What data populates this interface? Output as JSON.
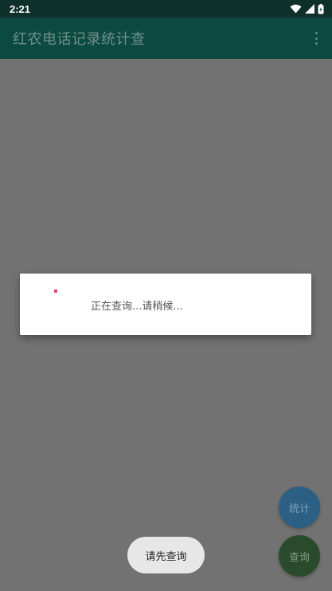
{
  "status_bar": {
    "time": "2:21",
    "icons": [
      "wifi-icon",
      "cellular-signal-icon",
      "battery-icon"
    ]
  },
  "app_bar": {
    "title": "红农电话记录统计查",
    "menu_icon": "overflow-menu-icon"
  },
  "dialog": {
    "message": "正在查询...请稍候..."
  },
  "fabs": {
    "stats_label": "统计",
    "query_label": "查询"
  },
  "toast": {
    "message": "请先查询"
  },
  "colors": {
    "status_bar": "#0e2f2a",
    "app_bar": "#0c4a41",
    "scrim": "#727272",
    "fab_stats": "#2b5f83",
    "fab_query": "#2a4a2c",
    "spinner": "#e0457b",
    "toast_bg": "#e7e7e7"
  }
}
